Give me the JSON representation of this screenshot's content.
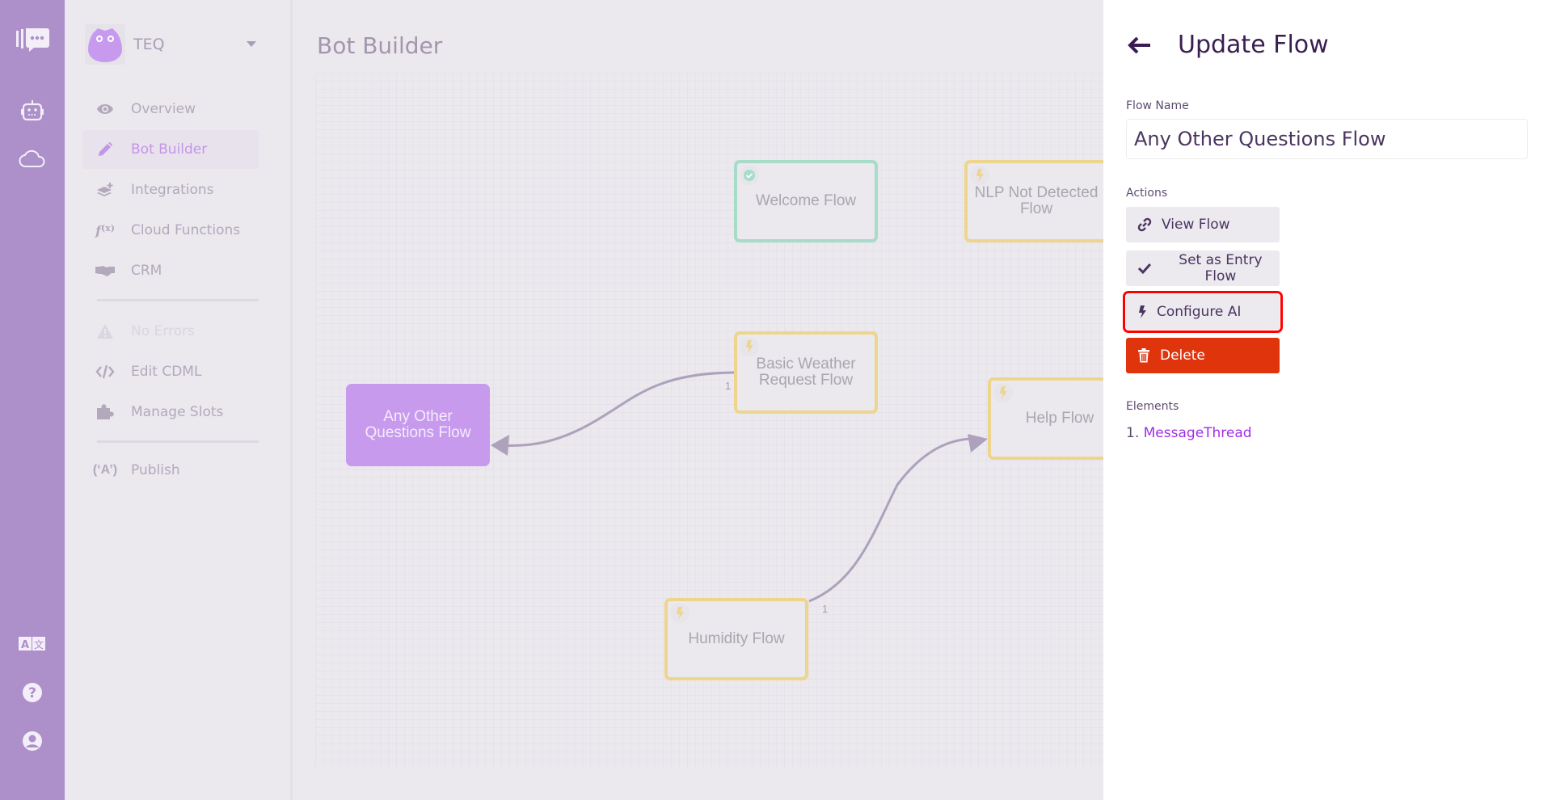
{
  "app": {
    "org_name": "TEQ",
    "page_title": "Bot Builder"
  },
  "rail": {
    "icons": [
      "logo-chat-icon",
      "bot-icon",
      "cloud-icon",
      "language-icon",
      "help-icon",
      "account-icon"
    ]
  },
  "sidebar": {
    "items": [
      {
        "label": "Overview",
        "icon": "eye-icon",
        "state": "normal"
      },
      {
        "label": "Bot Builder",
        "icon": "pencil-icon",
        "state": "active"
      },
      {
        "label": "Integrations",
        "icon": "layers-plus-icon",
        "state": "normal"
      },
      {
        "label": "Cloud Functions",
        "icon": "function-icon",
        "state": "normal"
      },
      {
        "label": "CRM",
        "icon": "handshake-icon",
        "state": "normal"
      },
      {
        "label": "No Errors",
        "icon": "warning-icon",
        "state": "disabled"
      },
      {
        "label": "Edit CDML",
        "icon": "code-icon",
        "state": "normal"
      },
      {
        "label": "Manage Slots",
        "icon": "puzzle-icon",
        "state": "normal"
      },
      {
        "label": "Publish",
        "icon": "broadcast-icon",
        "state": "normal"
      }
    ]
  },
  "canvas": {
    "nodes": [
      {
        "label": "Welcome Flow",
        "type": "entry",
        "badge": "check-icon"
      },
      {
        "label": "NLP Not Detected Flow",
        "type": "trigger",
        "badge": "bolt-icon"
      },
      {
        "label": "Basic Weather Request Flow",
        "type": "trigger",
        "badge": "bolt-icon"
      },
      {
        "label": "Any Other Questions Flow",
        "type": "selected",
        "badge": ""
      },
      {
        "label": "Help Flow",
        "type": "trigger",
        "badge": "bolt-icon"
      },
      {
        "label": "Humidity Flow",
        "type": "trigger",
        "badge": "bolt-icon"
      }
    ],
    "edges": [
      {
        "from": "Basic Weather Request Flow",
        "to": "Any Other Questions Flow",
        "label": "1"
      },
      {
        "from": "Humidity Flow",
        "to": "Help Flow",
        "label": "1"
      }
    ]
  },
  "panel": {
    "title": "Update Flow",
    "flow_name_label": "Flow Name",
    "flow_name_value": "Any Other Questions Flow",
    "actions_label": "Actions",
    "actions": [
      {
        "label": "View Flow",
        "icon": "link-icon"
      },
      {
        "label": "Set as Entry Flow",
        "icon": "check-icon"
      },
      {
        "label": "Configure AI",
        "icon": "bolt-icon",
        "highlighted": true
      },
      {
        "label": "Delete",
        "icon": "trash-icon",
        "danger": true
      }
    ],
    "elements_label": "Elements",
    "elements": [
      {
        "index": "1.",
        "name": "MessageThread"
      }
    ]
  },
  "colors": {
    "rail": "#ad8fca",
    "accent": "#c496e8",
    "entry_border": "#a6dcc8",
    "trigger_border": "#eed58e",
    "selected_node": "#c79aee",
    "danger": "#e0340d",
    "highlight": "#ff0000",
    "link": "#a02ee8"
  }
}
